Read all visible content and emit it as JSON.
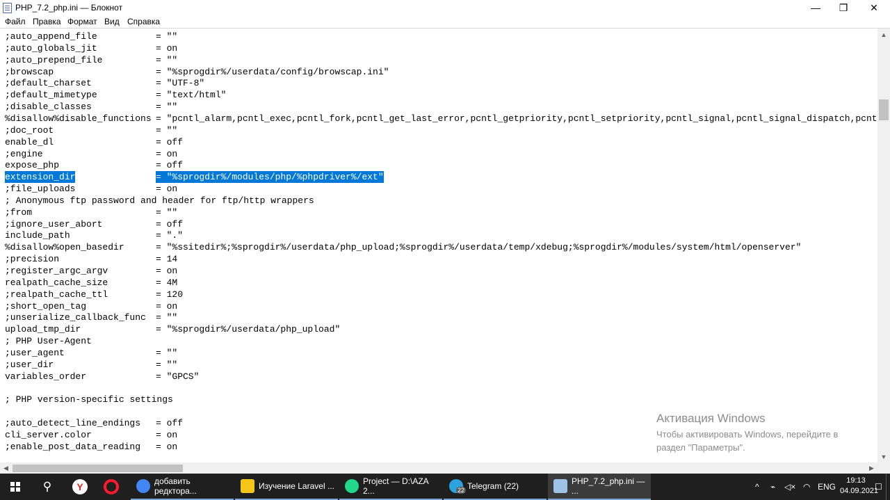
{
  "window": {
    "title": "PHP_7.2_php.ini — Блокнот",
    "minimize_glyph": "—",
    "maximize_glyph": "❐",
    "close_glyph": "✕"
  },
  "menu": [
    "Файл",
    "Правка",
    "Формат",
    "Вид",
    "Справка"
  ],
  "lines": [
    {
      "key": ";auto_append_file",
      "val": "= \"\""
    },
    {
      "key": ";auto_globals_jit",
      "val": "= on"
    },
    {
      "key": ";auto_prepend_file",
      "val": "= \"\""
    },
    {
      "key": ";browscap",
      "val": "= \"%sprogdir%/userdata/config/browscap.ini\""
    },
    {
      "key": ";default_charset",
      "val": "= \"UTF-8\""
    },
    {
      "key": ";default_mimetype",
      "val": "= \"text/html\""
    },
    {
      "key": ";disable_classes",
      "val": "= \"\""
    },
    {
      "key": "%disallow%disable_functions",
      "val": "= \"pcntl_alarm,pcntl_exec,pcntl_fork,pcntl_get_last_error,pcntl_getpriority,pcntl_setpriority,pcntl_signal,pcntl_signal_dispatch,pcntl_sig"
    },
    {
      "key": ";doc_root",
      "val": "= \"\""
    },
    {
      "key": "enable_dl",
      "val": "= off"
    },
    {
      "key": ";engine",
      "val": "= on"
    },
    {
      "key": "expose_php",
      "val": "= off"
    },
    {
      "key": "extension_dir",
      "val": "= \"%sprogdir%/modules/php/%phpdriver%/ext\"",
      "selected": true
    },
    {
      "key": ";file_uploads",
      "val": "= on"
    },
    {
      "key": "; Anonymous ftp password and header for ftp/http wrappers",
      "val": ""
    },
    {
      "key": ";from",
      "val": "= \"\""
    },
    {
      "key": ";ignore_user_abort",
      "val": "= off"
    },
    {
      "key": "include_path",
      "val": "= \".\""
    },
    {
      "key": "%disallow%open_basedir",
      "val": "= \"%ssitedir%;%sprogdir%/userdata/php_upload;%sprogdir%/userdata/temp/xdebug;%sprogdir%/modules/system/html/openserver\""
    },
    {
      "key": ";precision",
      "val": "= 14"
    },
    {
      "key": ";register_argc_argv",
      "val": "= on"
    },
    {
      "key": "realpath_cache_size",
      "val": "= 4M"
    },
    {
      "key": ";realpath_cache_ttl",
      "val": "= 120"
    },
    {
      "key": ";short_open_tag",
      "val": "= on"
    },
    {
      "key": ";unserialize_callback_func",
      "val": "= \"\""
    },
    {
      "key": "upload_tmp_dir",
      "val": "= \"%sprogdir%/userdata/php_upload\""
    },
    {
      "key": "; PHP User-Agent",
      "val": ""
    },
    {
      "key": ";user_agent",
      "val": "= \"\""
    },
    {
      "key": ";user_dir",
      "val": "= \"\""
    },
    {
      "key": "variables_order",
      "val": "= \"GPCS\""
    },
    {
      "key": "",
      "val": ""
    },
    {
      "key": "; PHP version-specific settings",
      "val": ""
    },
    {
      "key": "",
      "val": ""
    },
    {
      "key": ";auto_detect_line_endings",
      "val": "= off"
    },
    {
      "key": "cli_server.color",
      "val": "= on"
    },
    {
      "key": ";enable_post_data_reading",
      "val": "= on"
    }
  ],
  "activation": {
    "title": "Активация Windows",
    "line1": "Чтобы активировать Windows, перейдите в",
    "line2": "раздел \"Параметры\"."
  },
  "taskbar": {
    "search_glyph": "⚲",
    "yandex_letter": "Y",
    "opera_letter": "O",
    "apps": [
      {
        "label": "добавить редктора...",
        "color": "#4285f4"
      },
      {
        "label": "Изучение Laravel ...",
        "color": "#f5c518"
      },
      {
        "label": "Project — D:\\AZA 2...",
        "color": "#21d789"
      },
      {
        "label": "Telegram (22)",
        "color": "#2aa3de",
        "badge": "22"
      },
      {
        "label": "PHP_7.2_php.ini — ...",
        "color": "#9dc3e6"
      }
    ],
    "tray": {
      "chevron": "^",
      "network": "⌁",
      "volume": "◁×",
      "wifi": "◠",
      "lang": "ENG",
      "notif": "☐"
    },
    "time": "19:13",
    "date": "04.09.2021"
  },
  "colors": {
    "selection": "#0078d7",
    "taskbar": "#1f1f1f"
  }
}
